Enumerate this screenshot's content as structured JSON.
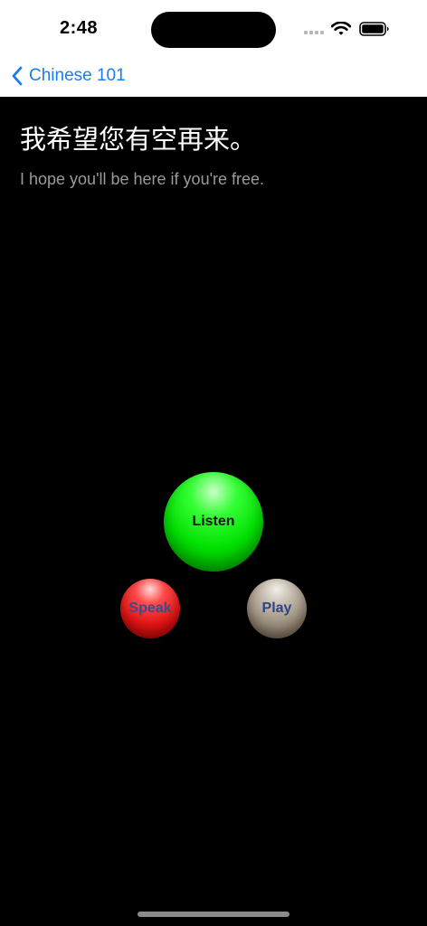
{
  "status_bar": {
    "time": "2:48"
  },
  "nav": {
    "back_label": "Chinese 101"
  },
  "lesson": {
    "chinese_text": "我希望您有空再来。",
    "english_text": "I hope you'll be here if you're free."
  },
  "controls": {
    "listen_label": "Listen",
    "speak_label": "Speak",
    "play_label": "Play"
  },
  "colors": {
    "accent": "#1a7cf3",
    "listen": "#00e000",
    "speak": "#e21616",
    "play": "#a89a88"
  }
}
